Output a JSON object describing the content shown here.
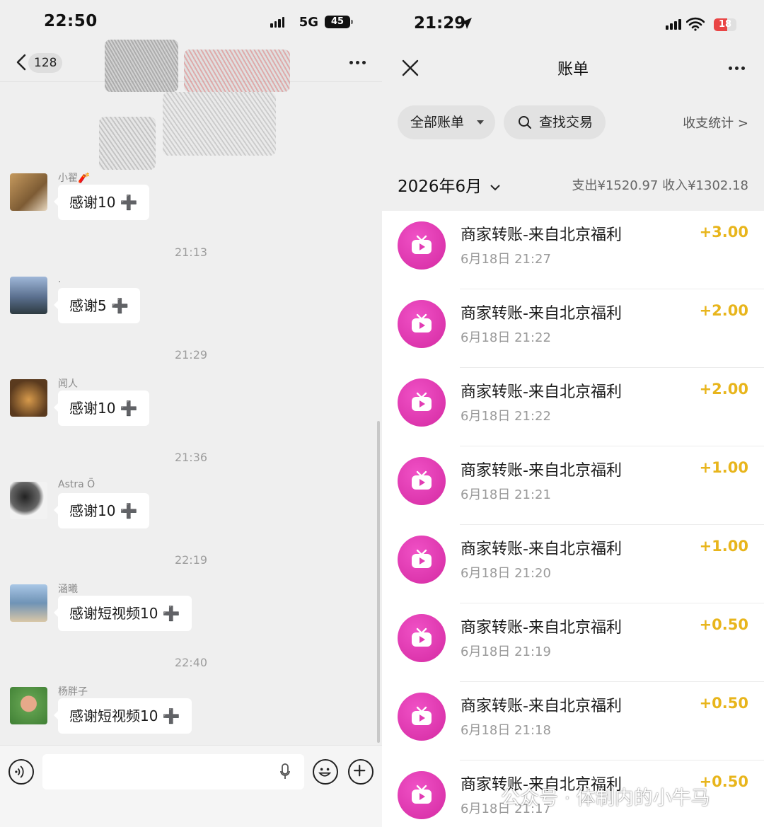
{
  "left": {
    "status_time": "22:50",
    "network": "5G",
    "battery": "45",
    "unread_count": "128",
    "messages": [
      {
        "sender": "小翟🧨",
        "text": "感谢10 ➕"
      },
      {
        "sender": ".",
        "text": "感谢5 ➕"
      },
      {
        "sender": "闻人",
        "text": "感谢10 ➕"
      },
      {
        "sender": "Astra Ö",
        "text": "感谢10 ➕"
      },
      {
        "sender": "涵曦",
        "text": "感谢短视频10 ➕"
      },
      {
        "sender": "杨胖子",
        "text": "感谢短视频10 ➕"
      }
    ],
    "timestamps": [
      "21:13",
      "21:29",
      "21:36",
      "22:19",
      "22:40"
    ]
  },
  "right": {
    "status_time": "21:29",
    "battery": "18",
    "title": "账单",
    "filter_all": "全部账单",
    "search_label": "查找交易",
    "stats_link": "收支统计 >",
    "month": "2026年6月",
    "summary": "支出¥1520.97  收入¥1302.18",
    "transactions": [
      {
        "title": "商家转账-来自北京福利",
        "date": "6月18日 21:27",
        "amount": "+3.00"
      },
      {
        "title": "商家转账-来自北京福利",
        "date": "6月18日 21:22",
        "amount": "+2.00"
      },
      {
        "title": "商家转账-来自北京福利",
        "date": "6月18日 21:22",
        "amount": "+2.00"
      },
      {
        "title": "商家转账-来自北京福利",
        "date": "6月18日 21:21",
        "amount": "+1.00"
      },
      {
        "title": "商家转账-来自北京福利",
        "date": "6月18日 21:20",
        "amount": "+1.00"
      },
      {
        "title": "商家转账-来自北京福利",
        "date": "6月18日 21:19",
        "amount": "+0.50"
      },
      {
        "title": "商家转账-来自北京福利",
        "date": "6月18日 21:18",
        "amount": "+0.50"
      },
      {
        "title": "商家转账-来自北京福利",
        "date": "6月18日 21:17",
        "amount": "+0.50"
      }
    ],
    "colors": {
      "amount": "#e8b51c",
      "icon": "#e23bb4"
    }
  },
  "watermark": "公众号 · 体制内的小牛马"
}
